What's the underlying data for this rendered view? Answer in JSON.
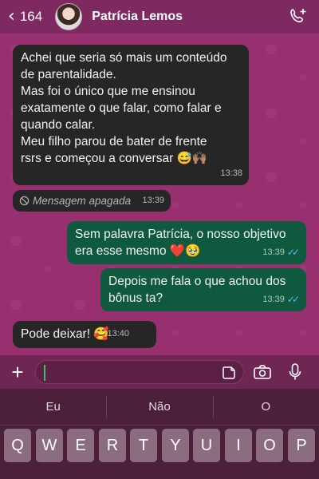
{
  "header": {
    "back_count": "164",
    "contact_name": "Patrícia Lemos"
  },
  "messages": [
    {
      "direction": "in",
      "lines": [
        "Achei que seria só mais um conteúdo",
        "de parentalidade.",
        "Mas foi o único que me ensinou",
        "exatamente o que falar, como falar e",
        "quando calar.",
        "Meu filho parou de bater de frente",
        "rsrs e começou a conversar 😅🙌🏽"
      ],
      "time": "13:38"
    },
    {
      "direction": "in",
      "deleted": true,
      "text": "Mensagem apagada",
      "time": "13:39"
    },
    {
      "direction": "out",
      "lines": [
        "Sem palavra Patrícia, o nosso objetivo",
        "era esse mesmo ❤️🥹"
      ],
      "time": "13:39",
      "status": "read"
    },
    {
      "direction": "out",
      "lines": [
        "Depois me fala o que achou dos",
        "bônus ta?"
      ],
      "time": "13:39",
      "status": "read"
    },
    {
      "direction": "in",
      "lines": [
        "Pode deixar! 🥰"
      ],
      "time": "13:40"
    }
  ],
  "input": {
    "value": ""
  },
  "keyboard": {
    "suggestions": [
      "Eu",
      "Não",
      "O"
    ],
    "row1": [
      "Q",
      "W",
      "E",
      "R",
      "T",
      "Y",
      "U",
      "I",
      "O",
      "P"
    ]
  },
  "colors": {
    "header_bg": "#7e2a60",
    "chat_bg": "#982f6f",
    "incoming_bubble": "#262626",
    "outgoing_bubble": "#0f5a3f",
    "read_ticks": "#53bdeb"
  }
}
